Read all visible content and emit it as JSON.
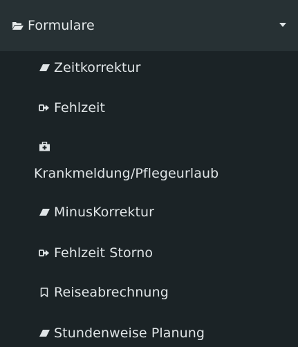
{
  "section": {
    "title": "Formulare",
    "icon": "folder-open-icon",
    "toggle_icon": "caret-down-icon"
  },
  "items": [
    {
      "label": "Zeitkorrektur",
      "icon": "eraser-icon"
    },
    {
      "label": "Fehlzeit",
      "icon": "sign-out-icon"
    },
    {
      "label": "Krankmeldung/Pflegeurlaub",
      "icon": "medkit-icon"
    },
    {
      "label": "MinusKorrektur",
      "icon": "eraser-icon"
    },
    {
      "label": "Fehlzeit Storno",
      "icon": "sign-out-icon"
    },
    {
      "label": "Reiseabrechnung",
      "icon": "bookmark-icon"
    },
    {
      "label": "Stundenweise Planung",
      "icon": "eraser-icon"
    }
  ],
  "colors": {
    "sidebar_bg": "#1b2326",
    "header_bg": "#273134",
    "text": "#dfe4e6"
  }
}
